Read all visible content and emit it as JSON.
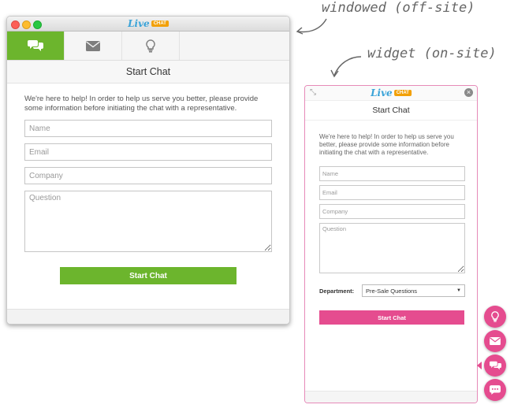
{
  "annotations": {
    "windowed": "windowed (off-site)",
    "widget": "widget (on-site)"
  },
  "logo": {
    "live": "Live",
    "chat": "CHAT"
  },
  "windowed": {
    "tabs": [
      {
        "icon": "chat-bubbles-icon",
        "active": true
      },
      {
        "icon": "envelope-icon",
        "active": false
      },
      {
        "icon": "lightbulb-icon",
        "active": false
      }
    ],
    "header": "Start Chat",
    "intro": "We're here to help! In order to help us serve you better, please provide some information before initiating the chat with a representative.",
    "fields": {
      "name": "Name",
      "email": "Email",
      "company": "Company",
      "question": "Question"
    },
    "button": "Start Chat",
    "accent": "#6cb52d"
  },
  "widget": {
    "header": "Start Chat",
    "intro": "We're here to help! In order to help us serve you better, please provide some information before initiating the chat with a representative.",
    "fields": {
      "name": "Name",
      "email": "Email",
      "company": "Company",
      "question": "Question"
    },
    "department_label": "Department:",
    "department_value": "Pre-Sale Questions",
    "button": "Start Chat",
    "accent": "#e54c8f",
    "side_buttons": [
      "lightbulb-icon",
      "envelope-icon",
      "chat-bubbles-icon",
      "speech-dots-icon"
    ]
  }
}
